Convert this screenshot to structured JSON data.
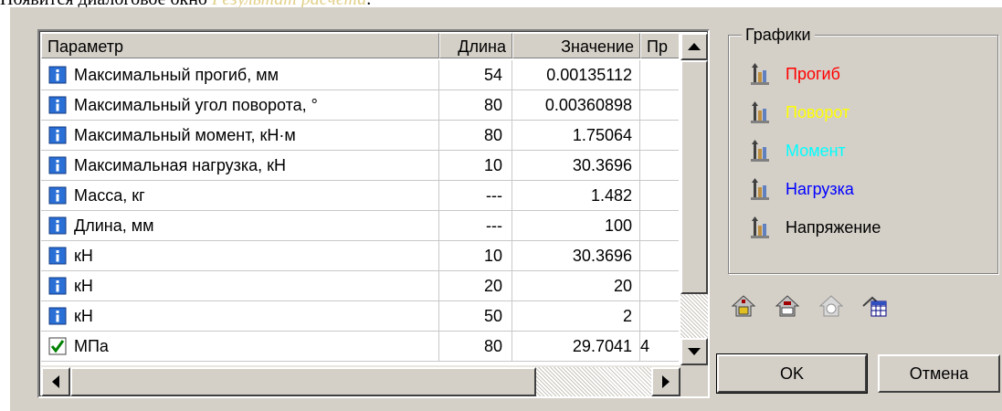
{
  "caption": {
    "prefix": "Появится диалоговое окно ",
    "emph": "Результат расчета",
    "suffix": "."
  },
  "table": {
    "columns": [
      "Параметр",
      "Длина",
      "Значение",
      "Пр"
    ],
    "rows": [
      {
        "icon": "info-icon",
        "param": "Максимальный прогиб, мм",
        "length": "54",
        "value": "0.00135112",
        "pr": ""
      },
      {
        "icon": "info-icon",
        "param": "Максимальный угол поворота, °",
        "length": "80",
        "value": "0.00360898",
        "pr": ""
      },
      {
        "icon": "info-icon",
        "param": "Максимальный момент, кН·м",
        "length": "80",
        "value": "1.75064",
        "pr": ""
      },
      {
        "icon": "info-icon",
        "param": "Максимальная нагрузка, кН",
        "length": "10",
        "value": "30.3696",
        "pr": ""
      },
      {
        "icon": "info-icon",
        "param": "Масса, кг",
        "length": "---",
        "value": "1.482",
        "pr": ""
      },
      {
        "icon": "info-icon",
        "param": "Длина, мм",
        "length": "---",
        "value": "100",
        "pr": ""
      },
      {
        "icon": "info-icon",
        "param": "кН",
        "length": "10",
        "value": "30.3696",
        "pr": ""
      },
      {
        "icon": "info-icon",
        "param": "кН",
        "length": "20",
        "value": "20",
        "pr": ""
      },
      {
        "icon": "info-icon",
        "param": "кН",
        "length": "50",
        "value": "2",
        "pr": ""
      },
      {
        "icon": "check-icon",
        "param": "МПа",
        "length": "80",
        "value": "29.7041",
        "pr": "4"
      }
    ]
  },
  "graphs": {
    "title": "Графики",
    "items": [
      {
        "label": "Прогиб",
        "color": "#ff0000"
      },
      {
        "label": "Поворот",
        "color": "#ffff00"
      },
      {
        "label": "Момент",
        "color": "#00ffff"
      },
      {
        "label": "Нагрузка",
        "color": "#0000ff"
      },
      {
        "label": "Напряжение",
        "color": "#000000"
      }
    ]
  },
  "toolbar": [
    "save-report-icon",
    "print-report-icon",
    "preview-report-icon",
    "export-table-icon"
  ],
  "buttons": {
    "ok": "OK",
    "cancel": "Отмена"
  }
}
